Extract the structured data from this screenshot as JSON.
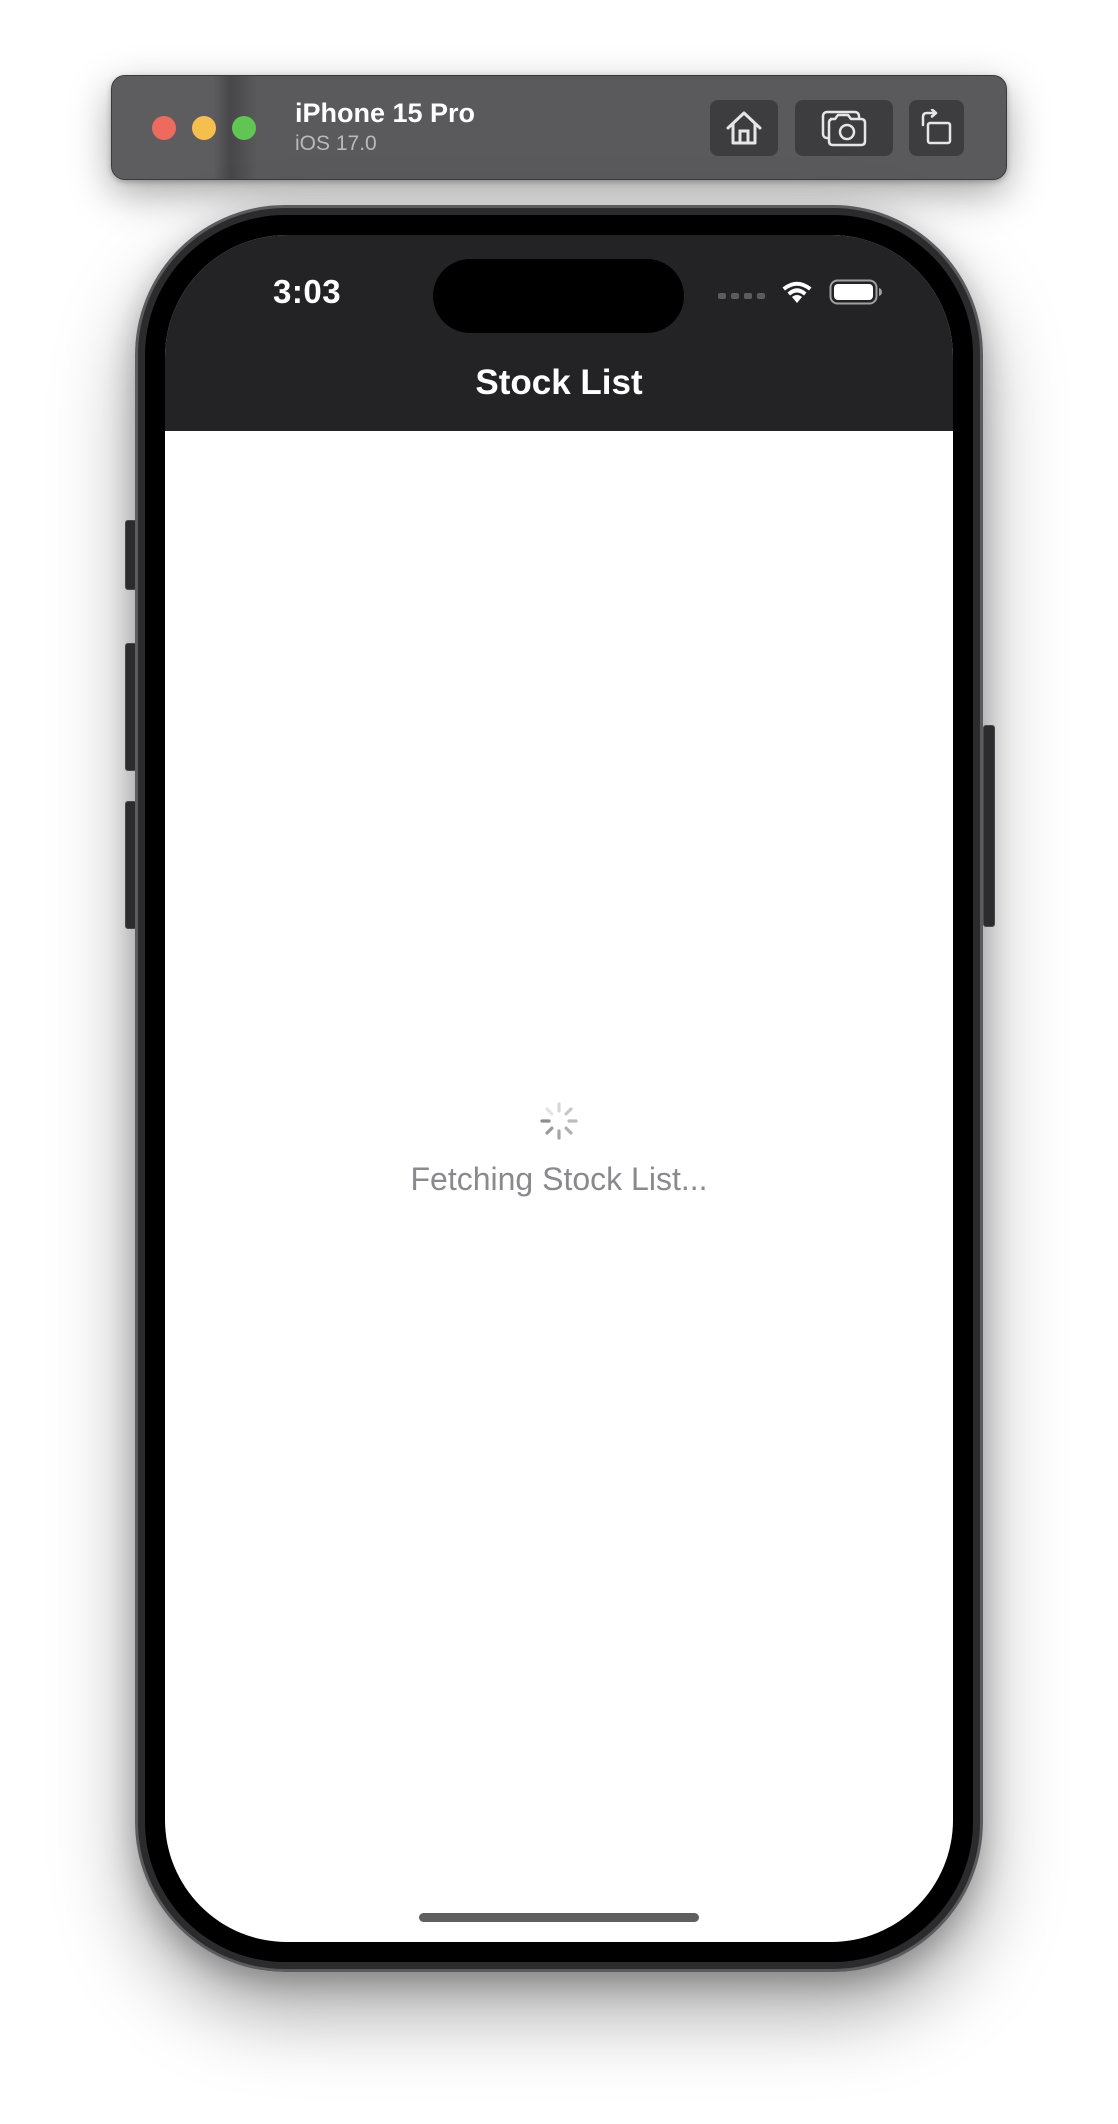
{
  "simulator": {
    "device_name": "iPhone 15 Pro",
    "os_version": "iOS 17.0",
    "buttons": [
      {
        "name": "home",
        "icon": "home-icon"
      },
      {
        "name": "screenshot",
        "icon": "camera-icon"
      },
      {
        "name": "rotate",
        "icon": "rotate-icon"
      }
    ],
    "window_controls": [
      "close",
      "minimize",
      "zoom"
    ]
  },
  "status_bar": {
    "time": "3:03",
    "icons": [
      "cellular-signal-icon",
      "wifi-icon",
      "battery-icon"
    ]
  },
  "nav_bar": {
    "title": "Stock List",
    "background": "#232325"
  },
  "content": {
    "loading_text": "Fetching Stock List...",
    "spinner_icon": "activity-indicator-icon"
  },
  "colors": {
    "traffic_red": "#ed6a5e",
    "traffic_yellow": "#f5bf4f",
    "traffic_green": "#61c554",
    "loading_text": "#8a8a8e"
  }
}
